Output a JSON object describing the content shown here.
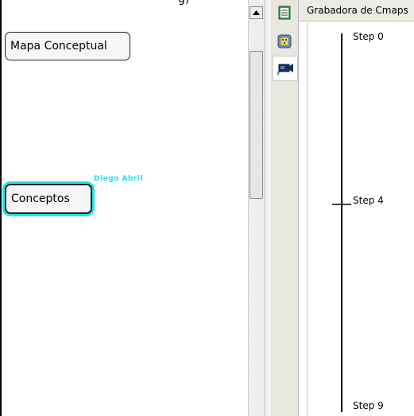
{
  "canvas": {
    "top_fragment": "g)",
    "concepts": [
      {
        "label": "Mapa Conceptual"
      },
      {
        "label": "Conceptos"
      }
    ],
    "author": "Diego Abril"
  },
  "sidebar": {
    "tools": [
      {
        "icon": "notes-icon"
      },
      {
        "icon": "navigator-icon"
      },
      {
        "icon": "recorder-camera-icon"
      }
    ]
  },
  "recorder": {
    "title": "Grabadora de Cmaps",
    "steps": [
      {
        "label": "Step 0"
      },
      {
        "label": "Step 4"
      },
      {
        "label": "Step 9"
      }
    ],
    "current_step": "Step 4"
  },
  "colors": {
    "selection_highlight": "#1ee6ee",
    "author_text": "#19e3ee"
  }
}
